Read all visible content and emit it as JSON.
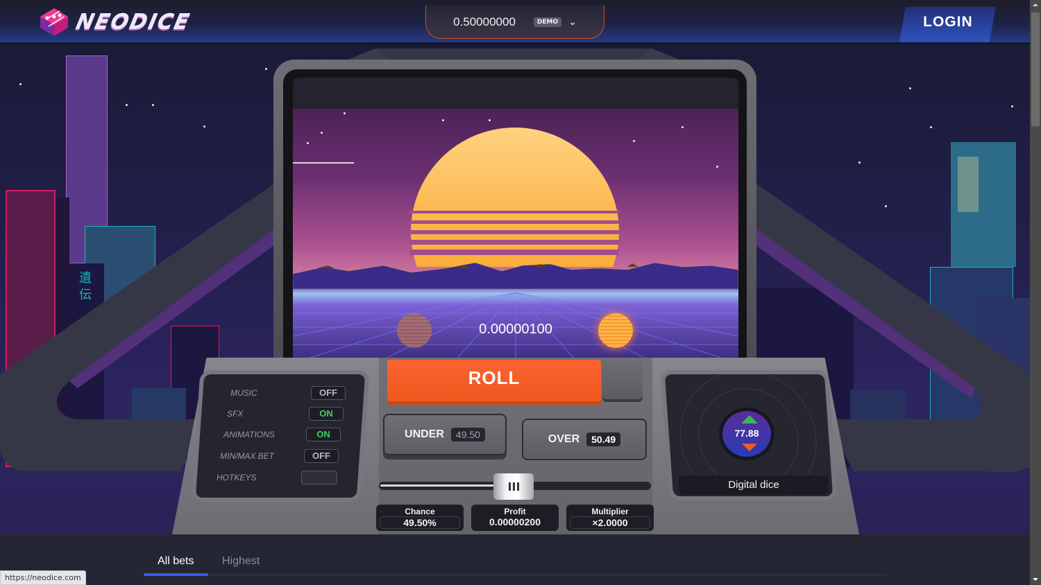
{
  "header": {
    "brand": "NEODICE",
    "balance": "0.50000000",
    "balance_mode_badge": "DEMO",
    "login_label": "LOGIN"
  },
  "screen": {
    "bet_amount": "0.00000100",
    "city_sign_chars": "遺 伝"
  },
  "settings": [
    {
      "label": "MUSIC",
      "state": "OFF"
    },
    {
      "label": "SFX",
      "state": "ON"
    },
    {
      "label": "ANIMATIONS",
      "state": "ON"
    },
    {
      "label": "MIN/MAX BET",
      "state": "OFF"
    },
    {
      "label": "HOTKEYS",
      "state": ""
    }
  ],
  "controls": {
    "roll_label": "ROLL",
    "under_label": "UNDER",
    "under_value": "49.50",
    "over_label": "OVER",
    "over_value": "50.49",
    "slider_value_percent": 49.5
  },
  "stats": {
    "chance_label": "Chance",
    "chance_value": "49.50%",
    "profit_label": "Profit",
    "profit_value": "0.00000200",
    "multiplier_label": "Multiplier",
    "multiplier_value": "×2.0000"
  },
  "game_mode": {
    "last_result": "77.88",
    "caption": "Digital dice"
  },
  "tabs": [
    {
      "label": "All bets",
      "active": true
    },
    {
      "label": "Highest",
      "active": false
    }
  ],
  "status_bar_url": "https://neodice.com",
  "colors": {
    "accent_orange": "#f0581f",
    "on_green": "#3fcf5c",
    "tab_active_blue": "#3659ef",
    "login_blue": "#2f55c2"
  }
}
